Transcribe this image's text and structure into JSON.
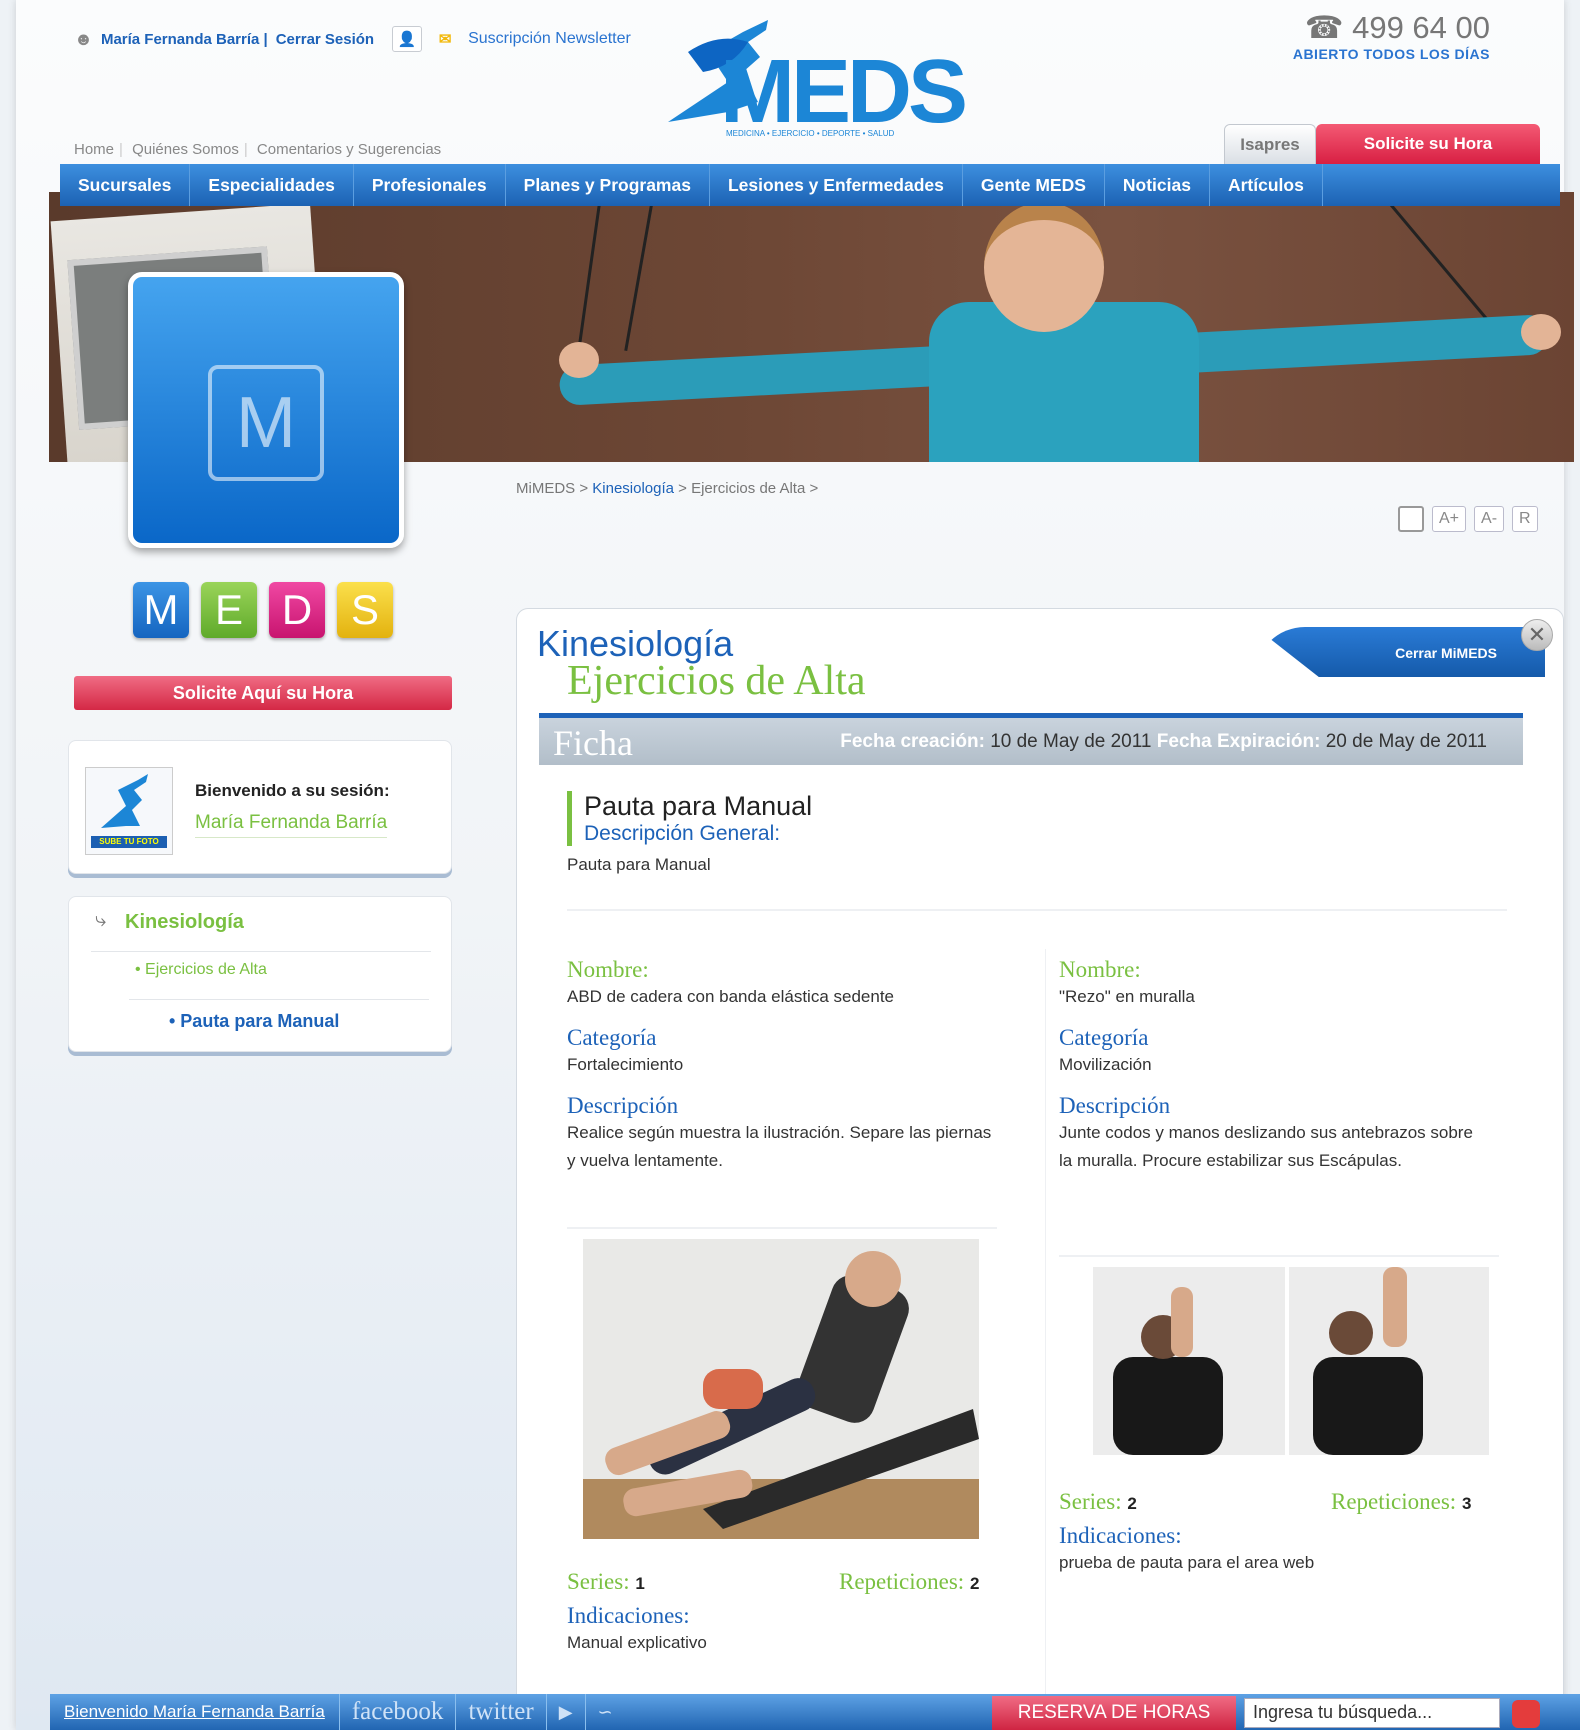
{
  "header": {
    "user_name": "María Fernanda Barría |",
    "logout": "Cerrar Sesión",
    "newsletter": "Suscripción Newsletter",
    "phone": "☎ 499 64 00",
    "hours": "ABIERTO TODOS LOS DÍAS",
    "logo_text": "MEDS",
    "logo_tagline": "MEDICINA • EJERCICIO • DEPORTE • SALUD",
    "links": [
      "Home",
      "Quiénes Somos",
      "Comentarios y Sugerencias"
    ],
    "isapres": "Isapres",
    "solicite": "Solicite su Hora"
  },
  "nav": [
    "Sucursales",
    "Especialidades",
    "Profesionales",
    "Planes y Programas",
    "Lesiones y Enfermedades",
    "Gente MEDS",
    "Noticias",
    "Artículos"
  ],
  "sidebar": {
    "tile_letter": "M",
    "letters": [
      "M",
      "E",
      "D",
      "S"
    ],
    "letter_colors": [
      "#1f7ad4",
      "#7ac041",
      "#e0258b",
      "#f1c72c"
    ],
    "solicite": "Solicite Aquí su Hora",
    "welcome_label": "Bienvenido a su sesión:",
    "welcome_name": "María Fernanda Barría",
    "photo_label": "SUBE TU FOTO",
    "tree_l1": "Kinesiología",
    "tree_l2": "• Ejercicios de Alta",
    "tree_l3": "• Pauta para Manual"
  },
  "breadcrumb": {
    "a": "MiMEDS > ",
    "b": "Kinesiología",
    "c": " > Ejercicios de Alta >"
  },
  "font_buttons": [
    "A+",
    "A-",
    "R"
  ],
  "panel": {
    "title": "Kinesiología",
    "subtitle": "Ejercicios de Alta",
    "close_label": "Cerrar MiMEDS",
    "ficha": "Ficha",
    "created_label": "Fecha creación:",
    "created": "10 de  May de 2011",
    "expires_label": "Fecha Expiración:",
    "expires": "20 de May de 2011",
    "pauta_title": "Pauta para Manual",
    "pauta_desc_label": "Descripción General:",
    "pauta_desc": "Pauta para Manual"
  },
  "exercises": [
    {
      "nombre_label": "Nombre:",
      "nombre": "ABD de cadera con banda elástica sedente",
      "cat_label": "Categoría",
      "cat": "Fortalecimiento",
      "desc_label": "Descripción",
      "desc": "Realice según muestra la ilustración. Separe las piernas y vuelva lentamente.",
      "series_label": "Series:",
      "series": "1",
      "rep_label": "Repeticiones:",
      "rep": "2",
      "ind_label": "Indicaciones:",
      "ind": "Manual explicativo"
    },
    {
      "nombre_label": "Nombre:",
      "nombre": "\"Rezo\" en muralla",
      "cat_label": "Categoría",
      "cat": "Movilización",
      "desc_label": "Descripción",
      "desc": "Junte codos y manos deslizando sus antebrazos sobre la muralla. Procure estabilizar sus Escápulas.",
      "series_label": "Series:",
      "series": "2",
      "rep_label": "Repeticiones:",
      "rep": "3",
      "ind_label": "Indicaciones:",
      "ind": "prueba de pauta para el area web"
    }
  ],
  "bottombar": {
    "welcome": "Bienvenido María Fernanda Barría",
    "facebook": "facebook",
    "twitter": "twitter",
    "reserva": "RESERVA DE HORAS",
    "search_placeholder": "Ingresa tu búsqueda..."
  }
}
